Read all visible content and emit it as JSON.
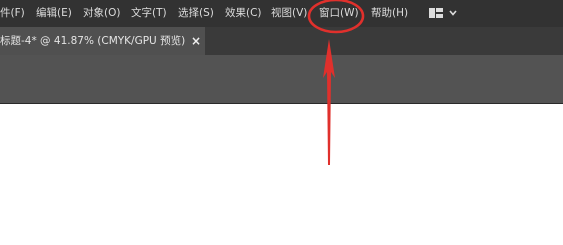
{
  "menubar": {
    "items": [
      {
        "label": "件(F)"
      },
      {
        "label": "编辑(E)"
      },
      {
        "label": "对象(O)"
      },
      {
        "label": "文字(T)"
      },
      {
        "label": "选择(S)"
      },
      {
        "label": "效果(C)"
      },
      {
        "label": "视图(V)"
      },
      {
        "label": "窗口(W)"
      },
      {
        "label": "帮助(H)"
      }
    ],
    "workspace_icon": "workspace-layout-icon",
    "dropdown_icon": "chevron-down-icon"
  },
  "document": {
    "tab_label": "标题-4* @ 41.87% (CMYK/GPU 预览)",
    "close_glyph": "×"
  },
  "annotation": {
    "color": "#e0302c",
    "highlighted_item": "窗口(W)"
  }
}
